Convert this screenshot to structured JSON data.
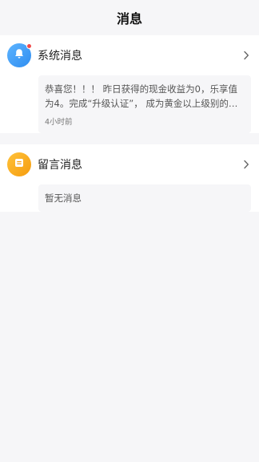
{
  "header": {
    "title": "消息"
  },
  "system": {
    "title": "系统消息",
    "icon": "bell-icon",
    "has_unread_dot": true,
    "message": "恭喜您！！！ 昨日获得的现金收益为0，乐享值为4。完成“升级认证”， 成为黄金以上级别的会…",
    "time": "4小时前"
  },
  "comments": {
    "title": "留言消息",
    "icon": "message-icon",
    "empty_text": "暂无消息"
  },
  "colors": {
    "system_icon_bg": "#3d9cf6",
    "comments_icon_bg": "#f7a818",
    "unread_dot": "#f04a4a"
  }
}
